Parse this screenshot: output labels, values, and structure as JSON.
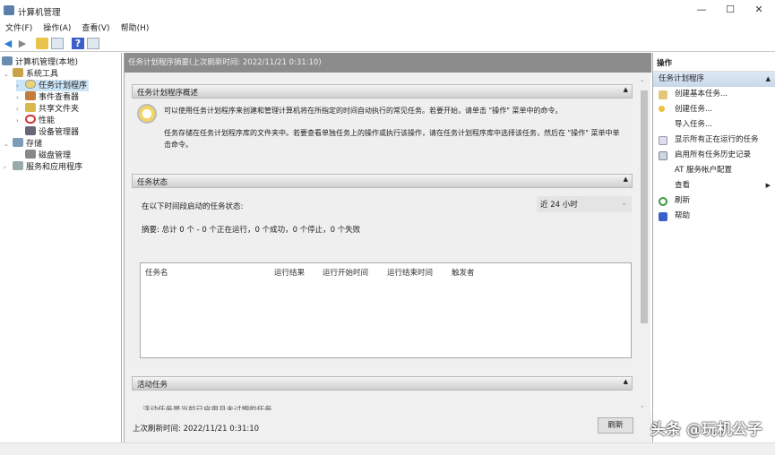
{
  "window": {
    "title": "计算机管理",
    "minimize": "—",
    "maximize": "☐",
    "close": "✕"
  },
  "menu": [
    "文件(F)",
    "操作(A)",
    "查看(V)",
    "帮助(H)"
  ],
  "tree": {
    "root": "计算机管理(本地)",
    "system_tools": "系统工具",
    "task_scheduler": "任务计划程序",
    "event_viewer": "事件查看器",
    "shared_folders": "共享文件夹",
    "performance": "性能",
    "device_manager": "设备管理器",
    "storage": "存储",
    "disk_management": "磁盘管理",
    "services_apps": "服务和应用程序"
  },
  "main": {
    "header": "任务计划程序摘要(上次刷新时间: 2022/11/21 0:31:10)",
    "overview": {
      "title": "任务计划程序概述",
      "p1": "可以使用任务计划程序来创建和管理计算机将在所指定的时间自动执行的常见任务。若要开始，请单击 \"操作\" 菜单中的命令。",
      "p2": "任务存储在任务计划程序库的文件夹中。若要查看单独任务上的操作或执行该操作，请在任务计划程序库中选择该任务，然后在 \"操作\" 菜单中单击命令。"
    },
    "status": {
      "title": "任务状态",
      "label": "在以下时间段启动的任务状态:",
      "range": "近 24 小时",
      "summary": "摘要: 总计 0 个 - 0 个正在运行，0 个成功，0 个停止，0 个失败",
      "columns": [
        "任务名",
        "运行结果",
        "运行开始时间",
        "运行结束时间",
        "触发者"
      ]
    },
    "active": {
      "title": "活动任务",
      "partial_text": "活动任务是当前已启用且未过期的任务。"
    },
    "last_refresh": "上次刷新时间: 2022/11/21 0:31:10",
    "refresh_button": "刷新"
  },
  "actions": {
    "title": "操作",
    "group": "任务计划程序",
    "items": [
      "创建基本任务...",
      "创建任务...",
      "导入任务...",
      "显示所有正在运行的任务",
      "启用所有任务历史记录",
      "AT 服务帐户配置",
      "查看",
      "刷新",
      "帮助"
    ]
  },
  "watermark": "头条 @玩机公子"
}
